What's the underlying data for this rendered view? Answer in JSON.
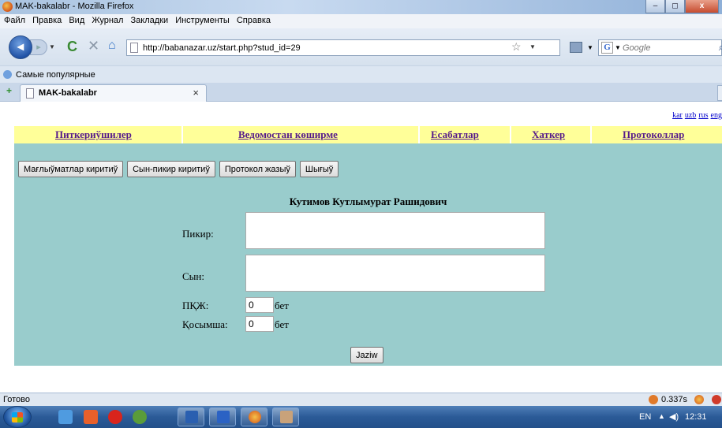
{
  "window": {
    "title": "MAK-bakalabr - Mozilla Firefox",
    "minimize": "–",
    "maximize": "◻",
    "close": "x"
  },
  "menu": [
    "Файл",
    "Правка",
    "Вид",
    "Журнал",
    "Закладки",
    "Инструменты",
    "Справка"
  ],
  "nav": {
    "url": "http://babanazar.uz/start.php?stud_id=29",
    "search_placeholder": "Google",
    "search_engine": "G"
  },
  "bookmarks": {
    "label": "Самые популярные"
  },
  "tab": {
    "label": "MAK-bakalabr",
    "close": "×"
  },
  "page": {
    "languages": [
      "kar",
      "uzb",
      "rus",
      "eng"
    ],
    "navigation": [
      "Питкериўшилер",
      "Ведомостан көширме",
      "Есабатлар",
      "Хаткер",
      "Протоколлар"
    ],
    "buttons": [
      "Мағлыўматлар киритиў",
      "Сын-пикир киритиў",
      "Протокол жазыў",
      "Шығыў"
    ],
    "student_name": "Кутимов Кутлымурат Рашидович",
    "form": {
      "feedback_label": "Пикир:",
      "review_label": "Сын:",
      "pkzh_label": "ПҚЖ:",
      "pkzh_value": "0",
      "pkzh_unit": "бет",
      "extra_label": "Қосымша:",
      "extra_value": "0",
      "extra_unit": "бет",
      "submit_label": "Jaziw"
    },
    "colors": {
      "nav_bg": "#ffff99",
      "content_bg": "#99cccc",
      "link": "#551a8b"
    }
  },
  "status": {
    "text": "Готово",
    "timing": "0.337s"
  },
  "taskbar": {
    "language": "EN",
    "clock": "12:31"
  }
}
